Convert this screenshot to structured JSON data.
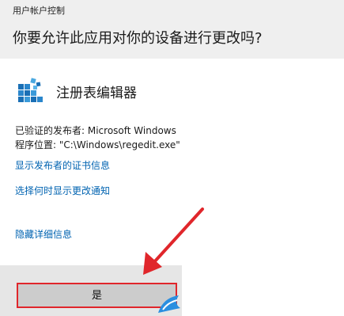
{
  "window": {
    "title": "用户帐户控制",
    "question": "你要允许此应用对你的设备进行更改吗?"
  },
  "app": {
    "name": "注册表编辑器",
    "icon": "regedit-cubes-icon"
  },
  "details": {
    "publisher_line": "已验证的发布者: Microsoft Windows",
    "location_line": "程序位置: \"C:\\Windows\\regedit.exe\""
  },
  "links": {
    "certificate": "显示发布者的证书信息",
    "change_notify": "选择何时显示更改通知",
    "hide_details": "隐藏详细信息"
  },
  "buttons": {
    "yes": "是"
  },
  "colors": {
    "header_bg": "#efefef",
    "link": "#0063b1",
    "highlight": "#e0262b",
    "footer_bg": "#e6e6e6",
    "button_bg": "#cccccc"
  },
  "annotations": {
    "arrow": "red-arrow-icon",
    "overlay": "bird-logo-icon"
  }
}
